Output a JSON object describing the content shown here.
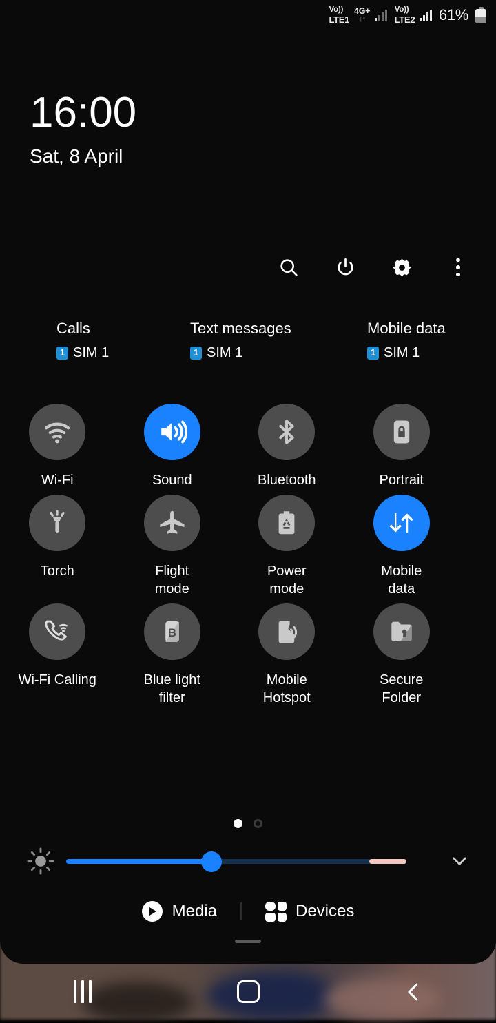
{
  "status_bar": {
    "sim1": {
      "volte": "Vo))",
      "network": "LTE1"
    },
    "data_indicator": {
      "label": "4G+",
      "arrows": "↓↑"
    },
    "sim2": {
      "volte": "Vo))",
      "network": "LTE2"
    },
    "battery_percent": "61%",
    "battery_icon": "battery-icon"
  },
  "clock": {
    "time": "16:00",
    "date": "Sat, 8 April"
  },
  "header_icons": [
    {
      "name": "search-icon",
      "label": "Search"
    },
    {
      "name": "power-icon",
      "label": "Power off"
    },
    {
      "name": "gear-icon",
      "label": "Settings"
    },
    {
      "name": "overflow-menu-icon",
      "label": "More options"
    }
  ],
  "sim_status": [
    {
      "title": "Calls",
      "badge": "1",
      "sim": "SIM 1"
    },
    {
      "title": "Text messages",
      "badge": "1",
      "sim": "SIM 1"
    },
    {
      "title": "Mobile data",
      "badge": "1",
      "sim": "SIM 1"
    }
  ],
  "toggles": [
    [
      {
        "label": "Wi-Fi",
        "icon": "wifi-icon",
        "active": false
      },
      {
        "label": "Sound",
        "icon": "volume-icon",
        "active": true
      },
      {
        "label": "Bluetooth",
        "icon": "bluetooth-icon",
        "active": false
      },
      {
        "label": "Portrait",
        "icon": "rotation-lock-icon",
        "active": false
      }
    ],
    [
      {
        "label": "Torch",
        "icon": "flashlight-icon",
        "active": false
      },
      {
        "label": "Flight\nmode",
        "icon": "airplane-icon",
        "active": false
      },
      {
        "label": "Power\nmode",
        "icon": "power-saving-icon",
        "active": false
      },
      {
        "label": "Mobile\ndata",
        "icon": "data-transfer-icon",
        "active": true
      }
    ],
    [
      {
        "label": "Wi-Fi Calling",
        "icon": "wifi-calling-icon",
        "active": false
      },
      {
        "label": "Blue light\nfilter",
        "icon": "blue-light-icon",
        "active": false
      },
      {
        "label": "Mobile\nHotspot",
        "icon": "hotspot-icon",
        "active": false
      },
      {
        "label": "Secure\nFolder",
        "icon": "secure-folder-icon",
        "active": false
      }
    ]
  ],
  "page_indicator": {
    "total": 2,
    "current": 1
  },
  "brightness": {
    "icon": "brightness-icon",
    "value_percent": 44,
    "expand_icon": "chevron-down-icon"
  },
  "bottom_bar": {
    "media_label": "Media",
    "media_icon": "play-circle-icon",
    "devices_label": "Devices",
    "devices_icon": "devices-grid-icon"
  },
  "navigation_bar": {
    "recents_icon": "recents-icon",
    "home_icon": "home-icon",
    "back_icon": "back-icon"
  },
  "colors": {
    "accent_blue": "#1a82ff",
    "tile_inactive": "#4d4d4d",
    "panel_bg": "#0a0a0a",
    "sim_badge": "#1f8fd6",
    "slider_warm": "#f3c6c0",
    "slider_track": "#16304f"
  }
}
